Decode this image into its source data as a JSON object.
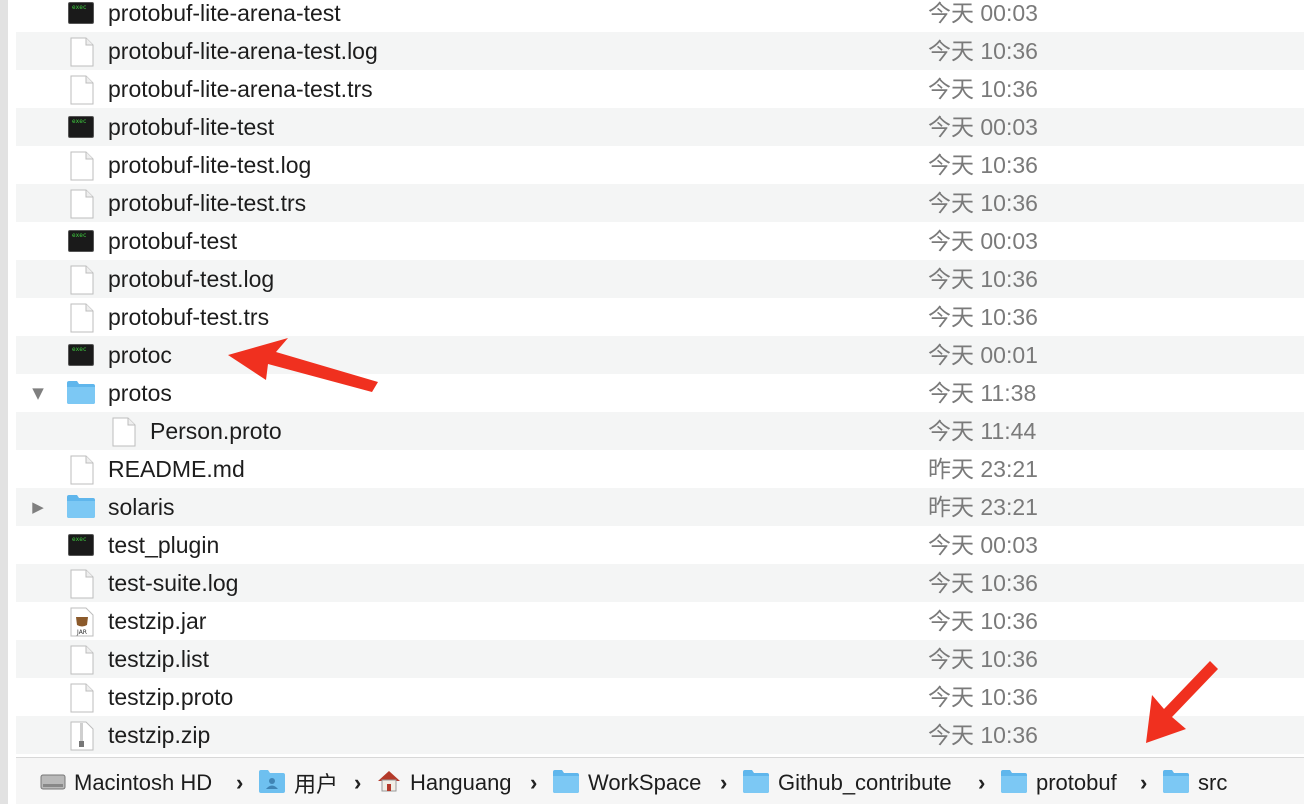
{
  "files": [
    {
      "name": "protobuf-lite-arena-test",
      "date": "今天 00:03",
      "icon": "terminal-exec-icon",
      "kind": "exec",
      "disclosure": ""
    },
    {
      "name": "protobuf-lite-arena-test.log",
      "date": "今天 10:36",
      "icon": "document-icon",
      "kind": "doc",
      "disclosure": ""
    },
    {
      "name": "protobuf-lite-arena-test.trs",
      "date": "今天 10:36",
      "icon": "document-icon",
      "kind": "doc",
      "disclosure": ""
    },
    {
      "name": "protobuf-lite-test",
      "date": "今天 00:03",
      "icon": "terminal-exec-icon",
      "kind": "exec",
      "disclosure": ""
    },
    {
      "name": "protobuf-lite-test.log",
      "date": "今天 10:36",
      "icon": "document-icon",
      "kind": "doc",
      "disclosure": ""
    },
    {
      "name": "protobuf-lite-test.trs",
      "date": "今天 10:36",
      "icon": "document-icon",
      "kind": "doc",
      "disclosure": ""
    },
    {
      "name": "protobuf-test",
      "date": "今天 00:03",
      "icon": "terminal-exec-icon",
      "kind": "exec",
      "disclosure": ""
    },
    {
      "name": "protobuf-test.log",
      "date": "今天 10:36",
      "icon": "document-icon",
      "kind": "doc",
      "disclosure": ""
    },
    {
      "name": "protobuf-test.trs",
      "date": "今天 10:36",
      "icon": "document-icon",
      "kind": "doc",
      "disclosure": ""
    },
    {
      "name": "protoc",
      "date": "今天 00:01",
      "icon": "terminal-exec-icon",
      "kind": "exec",
      "disclosure": ""
    },
    {
      "name": "protos",
      "date": "今天 11:38",
      "icon": "folder-icon",
      "kind": "folder",
      "disclosure": "▼"
    },
    {
      "name": "Person.proto",
      "date": "今天 11:44",
      "icon": "document-icon",
      "kind": "doc",
      "disclosure": "",
      "indent": true
    },
    {
      "name": "README.md",
      "date": "昨天 23:21",
      "icon": "document-icon",
      "kind": "doc",
      "disclosure": ""
    },
    {
      "name": "solaris",
      "date": "昨天 23:21",
      "icon": "folder-icon",
      "kind": "folder",
      "disclosure": "▶"
    },
    {
      "name": "test_plugin",
      "date": "今天 00:03",
      "icon": "terminal-exec-icon",
      "kind": "exec",
      "disclosure": ""
    },
    {
      "name": "test-suite.log",
      "date": "今天 10:36",
      "icon": "document-icon",
      "kind": "doc",
      "disclosure": ""
    },
    {
      "name": "testzip.jar",
      "date": "今天 10:36",
      "icon": "jar-icon",
      "kind": "jar",
      "disclosure": ""
    },
    {
      "name": "testzip.list",
      "date": "今天 10:36",
      "icon": "document-icon",
      "kind": "doc",
      "disclosure": ""
    },
    {
      "name": "testzip.proto",
      "date": "今天 10:36",
      "icon": "document-icon",
      "kind": "doc",
      "disclosure": ""
    },
    {
      "name": "testzip.zip",
      "date": "今天 10:36",
      "icon": "zip-icon",
      "kind": "zip",
      "disclosure": ""
    }
  ],
  "path_bar": [
    {
      "label": "Macintosh HD",
      "icon": "hard-drive-icon"
    },
    {
      "label": "用户",
      "icon": "users-folder-icon"
    },
    {
      "label": "Hanguang",
      "icon": "home-icon"
    },
    {
      "label": "WorkSpace",
      "icon": "folder-icon"
    },
    {
      "label": "Github_contribute",
      "icon": "folder-icon"
    },
    {
      "label": "protobuf",
      "icon": "folder-icon"
    },
    {
      "label": "src",
      "icon": "folder-icon"
    }
  ],
  "path_separator": "›",
  "exec_icon_text": "exec",
  "jar_icon_text": "JAR",
  "colors": {
    "annotation_arrow": "#f0301f",
    "folder": "#6ec0f0",
    "selection_stripe": "#f4f5f5"
  }
}
